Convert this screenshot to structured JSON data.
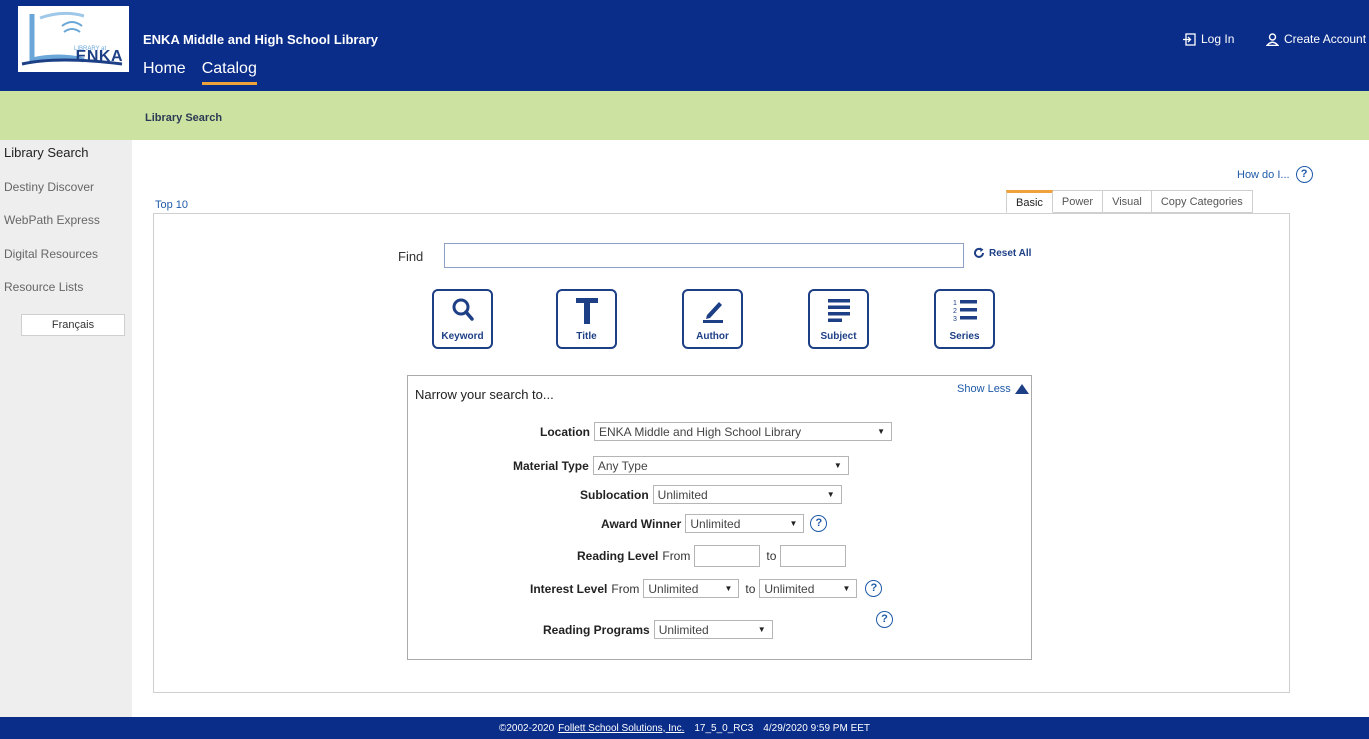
{
  "header": {
    "logo_text": "ENKA",
    "logo_tagline": "LIBRARY at",
    "site_title": "ENKA Middle and High School Library",
    "nav": [
      {
        "label": "Home"
      },
      {
        "label": "Catalog"
      }
    ],
    "login_label": "Log In",
    "create_account_label": "Create Account"
  },
  "breadcrumb": "Library Search",
  "sidebar": {
    "items": [
      {
        "label": "Library Search"
      },
      {
        "label": "Destiny Discover"
      },
      {
        "label": "WebPath Express"
      },
      {
        "label": "Digital Resources"
      },
      {
        "label": "Resource Lists"
      }
    ],
    "language_button": "Français"
  },
  "main": {
    "how_do_i": "How do I...",
    "top10": "Top 10",
    "tabs": [
      {
        "label": "Basic"
      },
      {
        "label": "Power"
      },
      {
        "label": "Visual"
      },
      {
        "label": "Copy Categories"
      }
    ],
    "find_label": "Find",
    "find_value": "",
    "reset_label": "Reset All",
    "search_buttons": [
      {
        "label": "Keyword",
        "icon": "search-icon"
      },
      {
        "label": "Title",
        "icon": "title-t-icon"
      },
      {
        "label": "Author",
        "icon": "pen-icon"
      },
      {
        "label": "Subject",
        "icon": "lines-icon"
      },
      {
        "label": "Series",
        "icon": "numbered-list-icon"
      }
    ]
  },
  "narrow": {
    "title": "Narrow your search to...",
    "show_less": "Show Less",
    "location": {
      "label": "Location",
      "value": "ENKA Middle and High School Library"
    },
    "material_type": {
      "label": "Material Type",
      "value": "Any Type"
    },
    "sublocation": {
      "label": "Sublocation",
      "value": "Unlimited"
    },
    "award_winner": {
      "label": "Award Winner",
      "value": "Unlimited"
    },
    "reading_level": {
      "label": "Reading Level",
      "from": "From",
      "to": "to"
    },
    "interest_level": {
      "label": "Interest Level",
      "from": "From",
      "from_value": "Unlimited",
      "to": "to",
      "to_value": "Unlimited"
    },
    "reading_programs": {
      "label": "Reading Programs",
      "value": "Unlimited"
    }
  },
  "footer": {
    "copyright": "©2002-2020",
    "company": "Follett School Solutions, Inc.",
    "version": "17_5_0_RC3",
    "timestamp": "4/29/2020 9:59 PM EET"
  },
  "colors": {
    "header": "#0b2d8a",
    "greenbar": "#cce2a0",
    "accent": "#f0a23a",
    "link": "#1e5aa8"
  }
}
